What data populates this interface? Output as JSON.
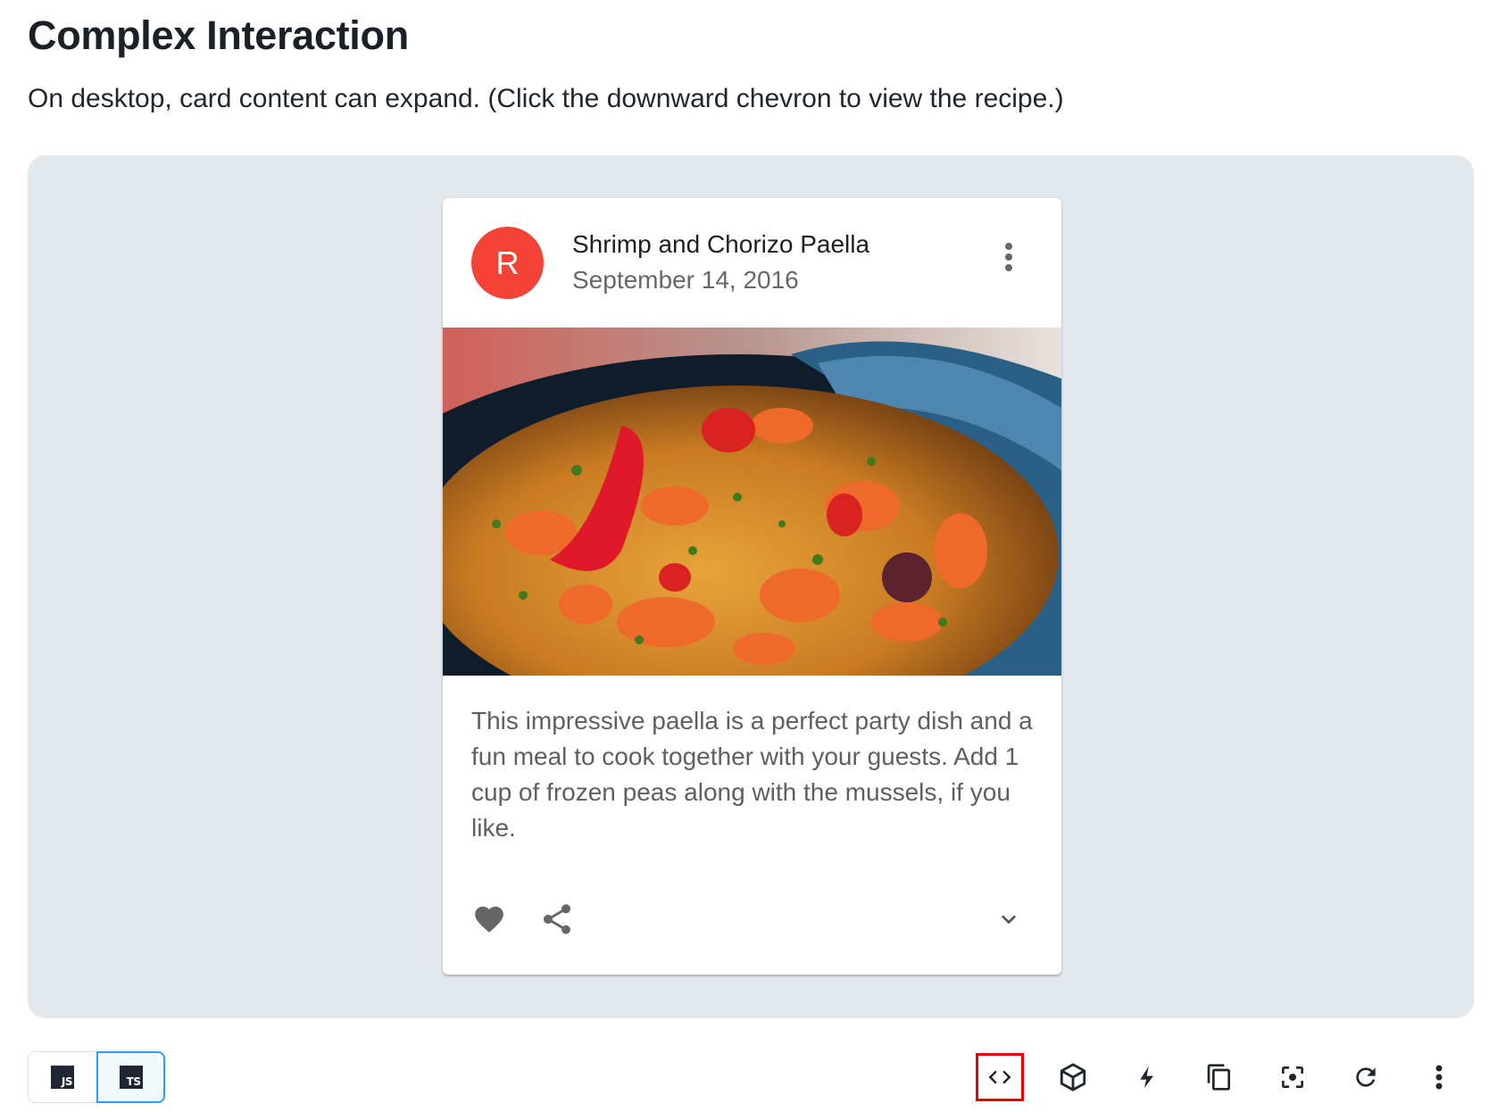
{
  "heading": "Complex Interaction",
  "description": "On desktop, card content can expand. (Click the downward chevron to view the recipe.)",
  "card": {
    "avatar_letter": "R",
    "title": "Shrimp and Chorizo Paella",
    "date": "September 14, 2016",
    "body": "This impressive paella is a perfect party dish and a fun meal to cook together with your guests. Add 1 cup of frozen peas along with the mussels, if you like.",
    "icons": {
      "menu": "more-vert-icon",
      "favorite": "heart-icon",
      "share": "share-icon",
      "expand": "chevron-down-icon"
    },
    "avatar_color": "#f44336"
  },
  "toolbar": {
    "languages": [
      {
        "label": "JS",
        "selected": false
      },
      {
        "label": "TS",
        "selected": true
      }
    ],
    "tools": [
      "code-icon",
      "cube-icon",
      "bolt-icon",
      "copy-icon",
      "focus-icon",
      "refresh-icon",
      "more-vert-icon"
    ]
  },
  "colors": {
    "demo_background": "#e3e8ed",
    "selected_border": "#3399ff",
    "highlight": "#e8000b"
  }
}
